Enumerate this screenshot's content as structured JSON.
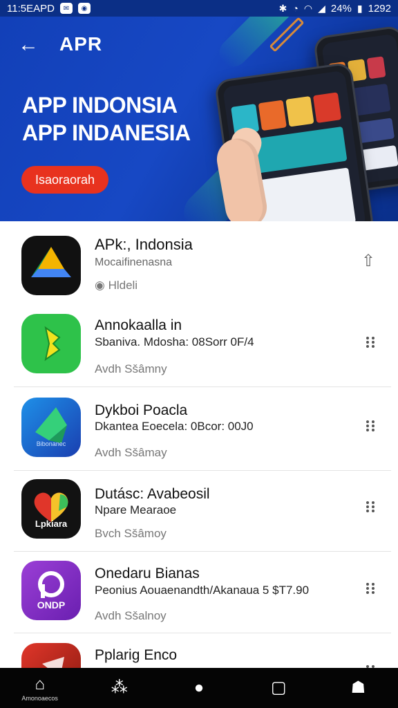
{
  "status_bar": {
    "time": "11:5EAPD",
    "right_text": "24%",
    "clock": "1292"
  },
  "header": {
    "back_label": "←",
    "brand": "APR",
    "title_line1": "APP INDONSIA",
    "title_line2": "APP INDANESIA",
    "cta_label": "Isaoraorah"
  },
  "apps": [
    {
      "title": "APk:, Indonsia",
      "subtitle": "Mocaifinenasna",
      "meta": "Hldeli",
      "action": "pin-icon"
    },
    {
      "title": "Annokaalla in",
      "subtitle": "Sbaniva. Mdosha: 08Sorr 0F/4",
      "meta": "Avdh Sšâmny",
      "action": "more-icon"
    },
    {
      "title": "Dykboi Poacla",
      "subtitle": "Dkantea Eoecela: 0Bcor: 00J0",
      "meta": "Avdh Sšâmay",
      "icon_label": "Bibonanec",
      "action": "more-icon"
    },
    {
      "title": "Dutásc: Avabeosil",
      "subtitle": "Npare Mearaoe",
      "meta": "Bvch Sšâmoy",
      "icon_label": "Lpkiara",
      "action": "more-icon"
    },
    {
      "title": "Onedaru Bianas",
      "subtitle": "Peonius Aouaenandth/Akanaua 5 $T7.90",
      "meta": "Avdh Sšalnoy",
      "icon_label": "ONDP",
      "action": "more-icon"
    },
    {
      "title": "Pplarig Enco",
      "subtitle": "",
      "meta": "",
      "action": "more-icon"
    }
  ],
  "bottom_nav": [
    {
      "icon": "home-icon",
      "label": "Amonoaecos"
    },
    {
      "icon": "apps-icon",
      "label": ""
    },
    {
      "icon": "circle-icon",
      "label": ""
    },
    {
      "icon": "square-icon",
      "label": ""
    },
    {
      "icon": "profile-icon",
      "label": ""
    }
  ],
  "colors": {
    "hero_blue": "#1240b8",
    "cta_red": "#e8321e",
    "nav_black": "#050505"
  }
}
